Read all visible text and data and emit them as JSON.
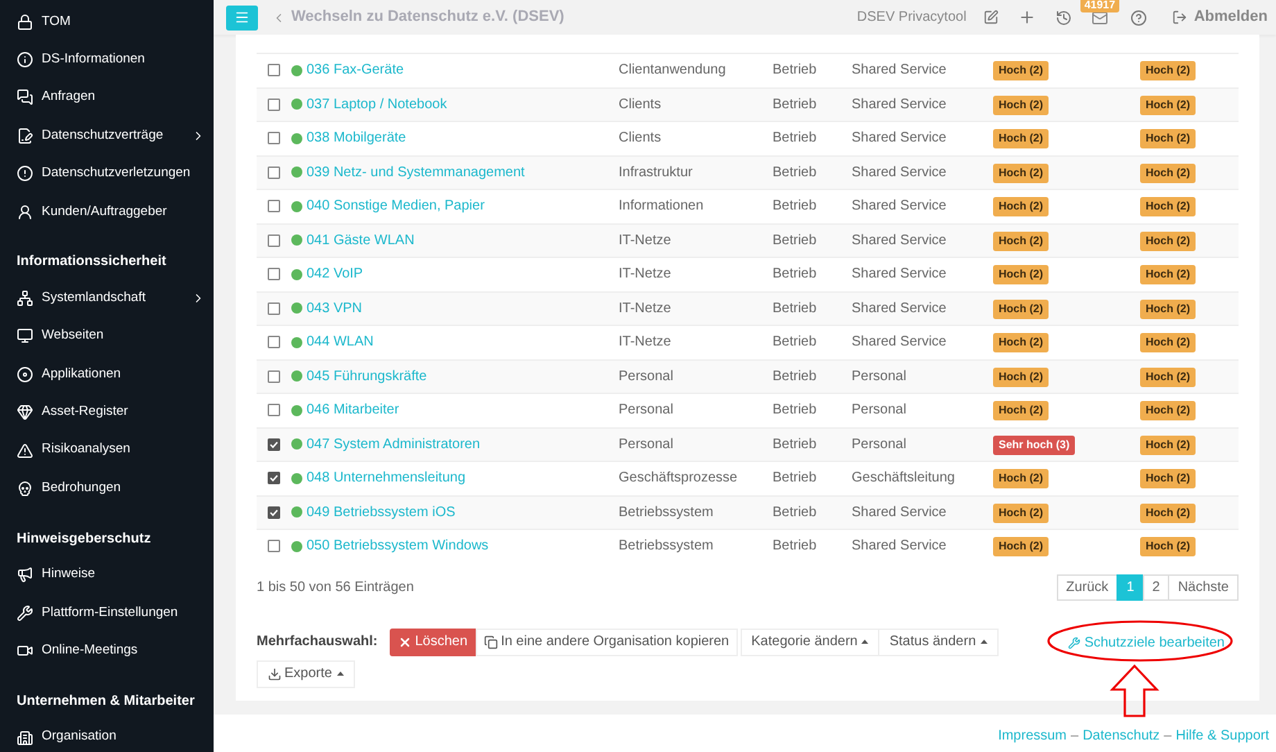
{
  "sidebar": {
    "sections": [
      {
        "items": [
          {
            "label": "TOM",
            "has_submenu": false
          },
          {
            "label": "DS-Informationen",
            "has_submenu": false
          },
          {
            "label": "Anfragen",
            "has_submenu": false
          },
          {
            "label": "Datenschutzverträge",
            "has_submenu": true
          },
          {
            "label": "Datenschutzverletzungen",
            "has_submenu": false
          },
          {
            "label": "Kunden/Auftraggeber",
            "has_submenu": false
          }
        ]
      },
      {
        "title": "Informationssicherheit",
        "items": [
          {
            "label": "Systemlandschaft",
            "has_submenu": true
          },
          {
            "label": "Webseiten",
            "has_submenu": false
          },
          {
            "label": "Applikationen",
            "has_submenu": false
          },
          {
            "label": "Asset-Register",
            "has_submenu": false
          },
          {
            "label": "Risikoanalysen",
            "has_submenu": false
          },
          {
            "label": "Bedrohungen",
            "has_submenu": false
          }
        ]
      },
      {
        "title": "Hinweisgeberschutz",
        "items": [
          {
            "label": "Hinweise",
            "has_submenu": false
          },
          {
            "label": "Plattform-Einstellungen",
            "has_submenu": false
          },
          {
            "label": "Online-Meetings",
            "has_submenu": false
          }
        ]
      },
      {
        "title": "Unternehmen & Mitarbeiter",
        "items": [
          {
            "label": "Organisation",
            "has_submenu": false
          }
        ]
      }
    ]
  },
  "topbar": {
    "breadcrumb": "Wechseln zu Datenschutz e.V. (DSEV)",
    "app_name": "DSEV Privacytool",
    "mail_badge": "41917",
    "logout": "Abmelden"
  },
  "table": {
    "rows": [
      {
        "checked": false,
        "color": "#5cb85c",
        "name": "036 Fax-Geräte",
        "category": "Clientanwendung",
        "status": "Betrieb",
        "service": "Shared Service",
        "protection_1": {
          "kind": "high",
          "label": "Hoch (2)"
        },
        "protection_2": {
          "kind": "high",
          "label": "Hoch (2)"
        }
      },
      {
        "checked": false,
        "color": "#5cb85c",
        "name": "037 Laptop / Notebook",
        "category": "Clients",
        "status": "Betrieb",
        "service": "Shared Service",
        "protection_1": {
          "kind": "high",
          "label": "Hoch (2)"
        },
        "protection_2": {
          "kind": "high",
          "label": "Hoch (2)"
        }
      },
      {
        "checked": false,
        "color": "#5cb85c",
        "name": "038 Mobilgeräte",
        "category": "Clients",
        "status": "Betrieb",
        "service": "Shared Service",
        "protection_1": {
          "kind": "high",
          "label": "Hoch (2)"
        },
        "protection_2": {
          "kind": "high",
          "label": "Hoch (2)"
        }
      },
      {
        "checked": false,
        "color": "#5cb85c",
        "name": "039 Netz- und Systemmanagement",
        "category": "Infrastruktur",
        "status": "Betrieb",
        "service": "Shared Service",
        "protection_1": {
          "kind": "high",
          "label": "Hoch (2)"
        },
        "protection_2": {
          "kind": "high",
          "label": "Hoch (2)"
        }
      },
      {
        "checked": false,
        "color": "#5cb85c",
        "name": "040 Sonstige Medien, Papier",
        "category": "Informationen",
        "status": "Betrieb",
        "service": "Shared Service",
        "protection_1": {
          "kind": "high",
          "label": "Hoch (2)"
        },
        "protection_2": {
          "kind": "high",
          "label": "Hoch (2)"
        }
      },
      {
        "checked": false,
        "color": "#5cb85c",
        "name": "041 Gäste WLAN",
        "category": "IT-Netze",
        "status": "Betrieb",
        "service": "Shared Service",
        "protection_1": {
          "kind": "high",
          "label": "Hoch (2)"
        },
        "protection_2": {
          "kind": "high",
          "label": "Hoch (2)"
        }
      },
      {
        "checked": false,
        "color": "#5cb85c",
        "name": "042 VoIP",
        "category": "IT-Netze",
        "status": "Betrieb",
        "service": "Shared Service",
        "protection_1": {
          "kind": "high",
          "label": "Hoch (2)"
        },
        "protection_2": {
          "kind": "high",
          "label": "Hoch (2)"
        }
      },
      {
        "checked": false,
        "color": "#5cb85c",
        "name": "043 VPN",
        "category": "IT-Netze",
        "status": "Betrieb",
        "service": "Shared Service",
        "protection_1": {
          "kind": "high",
          "label": "Hoch (2)"
        },
        "protection_2": {
          "kind": "high",
          "label": "Hoch (2)"
        }
      },
      {
        "checked": false,
        "color": "#5cb85c",
        "name": "044 WLAN",
        "category": "IT-Netze",
        "status": "Betrieb",
        "service": "Shared Service",
        "protection_1": {
          "kind": "high",
          "label": "Hoch (2)"
        },
        "protection_2": {
          "kind": "high",
          "label": "Hoch (2)"
        }
      },
      {
        "checked": false,
        "color": "#5cb85c",
        "name": "045 Führungskräfte",
        "category": "Personal",
        "status": "Betrieb",
        "service": "Personal",
        "protection_1": {
          "kind": "high",
          "label": "Hoch (2)"
        },
        "protection_2": {
          "kind": "high",
          "label": "Hoch (2)"
        }
      },
      {
        "checked": false,
        "color": "#5cb85c",
        "name": "046 Mitarbeiter",
        "category": "Personal",
        "status": "Betrieb",
        "service": "Personal",
        "protection_1": {
          "kind": "high",
          "label": "Hoch (2)"
        },
        "protection_2": {
          "kind": "high",
          "label": "Hoch (2)"
        }
      },
      {
        "checked": true,
        "color": "#5cb85c",
        "name": "047 System Administratoren",
        "category": "Personal",
        "status": "Betrieb",
        "service": "Personal",
        "protection_1": {
          "kind": "very_high",
          "label": "Sehr hoch (3)"
        },
        "protection_2": {
          "kind": "high",
          "label": "Hoch (2)"
        }
      },
      {
        "checked": true,
        "color": "#5cb85c",
        "name": "048 Unternehmensleitung",
        "category": "Geschäftsprozesse",
        "status": "Betrieb",
        "service": "Geschäftsleitung",
        "protection_1": {
          "kind": "high",
          "label": "Hoch (2)"
        },
        "protection_2": {
          "kind": "high",
          "label": "Hoch (2)"
        }
      },
      {
        "checked": true,
        "color": "#5cb85c",
        "name": "049 Betriebssystem iOS",
        "category": "Betriebssystem",
        "status": "Betrieb",
        "service": "Shared Service",
        "protection_1": {
          "kind": "high",
          "label": "Hoch (2)"
        },
        "protection_2": {
          "kind": "high",
          "label": "Hoch (2)"
        }
      },
      {
        "checked": false,
        "color": "#5cb85c",
        "name": "050 Betriebssystem Windows",
        "category": "Betriebssystem",
        "status": "Betrieb",
        "service": "Shared Service",
        "protection_1": {
          "kind": "high",
          "label": "Hoch (2)"
        },
        "protection_2": {
          "kind": "high",
          "label": "Hoch (2)"
        }
      }
    ]
  },
  "info": "1 bis 50 von 56 Einträgen",
  "pagination": [
    {
      "label": "Zurück",
      "selected": false
    },
    {
      "label": "1",
      "selected": true
    },
    {
      "label": "2",
      "selected": false
    },
    {
      "label": "Nächste",
      "selected": false
    }
  ],
  "bulk_actions": {
    "label": "Mehrfachauswahl:",
    "buttons": [
      {
        "kind": "delete",
        "label": "Löschen"
      },
      {
        "kind": "copy",
        "label": "In eine andere Organisation kopieren"
      },
      {
        "kind": "dropdown",
        "label": "Kategorie ändern"
      },
      {
        "kind": "dropdown",
        "label": "Status ändern"
      }
    ],
    "export": "Exporte",
    "edit_link": "Schutzziele bearbeiten"
  },
  "footer": {
    "links": [
      "Impressum",
      "Datenschutz",
      "Hilfe & Support"
    ],
    "separator": "–"
  }
}
